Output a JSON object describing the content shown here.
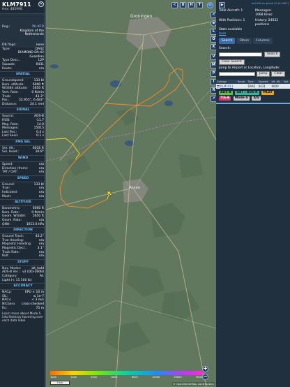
{
  "aircraft": {
    "callsign": "KLM7911",
    "hex_line": "Hex: 485998",
    "reg_label": "Reg.:",
    "reg_value": "PH-KFD",
    "country": "Kingdom of the Netherlands",
    "db_flags_label": "DB flags:",
    "db_flags_value": "none",
    "type_label": "Type:",
    "type_value": "DA42",
    "type_desc": "DIAMOND DA-42 Guardian",
    "type_desc_label": "Type Desc.:",
    "type_desc_value": "L2P",
    "squawk_label": "Squawk:",
    "squawk_value": "0431",
    "route_label": "Route:",
    "route_value": "n/a"
  },
  "sections": {
    "spatial": "SPATIAL",
    "signal": "SIGNAL",
    "fms_sel": "FMS SEL",
    "wind": "WIND",
    "speed": "SPEED",
    "altitude": "ALTITUDE",
    "direction": "DIRECTION",
    "stuff": "STUFF",
    "accuracy": "ACCURACY"
  },
  "spatial": [
    {
      "k": "Groundspeed:",
      "v": "133 kt"
    },
    {
      "k": "Baro. altitude:",
      "v": "6000 ft"
    },
    {
      "k": "WGS84 altitude:",
      "v": "5650 ft"
    },
    {
      "k": "Vert. Rate:",
      "v": "0 ft/min"
    },
    {
      "k": "Track:",
      "v": "43.3°"
    },
    {
      "k": "Pos.:",
      "v": "52.955°, 6.483°"
    },
    {
      "k": "Distance:",
      "v": "24.1 nmi"
    }
  ],
  "signal": [
    {
      "k": "Source:",
      "v": "ADS-B"
    },
    {
      "k": "RSSI:",
      "v": "-11.7"
    },
    {
      "k": "Msg. Rate:",
      "v": "14.0"
    },
    {
      "k": "Messages:",
      "v": "15015"
    },
    {
      "k": "Last Pos.:",
      "v": "0.4 s"
    },
    {
      "k": "Last Seen:",
      "v": "0.1 s"
    }
  ],
  "fms": [
    {
      "k": "Sel. Alt.:",
      "v": "6016 ft"
    },
    {
      "k": "Sel. Head.:",
      "v": "30.9°"
    }
  ],
  "wind": [
    {
      "k": "Speed:",
      "v": "n/a"
    },
    {
      "k": "Direction (from):",
      "v": "n/a"
    },
    {
      "k": "TAT / OAT:",
      "v": "n/a"
    }
  ],
  "speed": [
    {
      "k": "Ground:",
      "v": "133 kt"
    },
    {
      "k": "True:",
      "v": "n/a"
    },
    {
      "k": "Indicated:",
      "v": "n/a"
    },
    {
      "k": "Mach:",
      "v": "n/a"
    }
  ],
  "altitude": [
    {
      "k": "Barometric:",
      "v": "6000 ft"
    },
    {
      "k": "Baro. Rate:",
      "v": "0 ft/min"
    },
    {
      "k": "Geom. WGS84:",
      "v": "5650 ft"
    },
    {
      "k": "Geom. Rate:",
      "v": "n/a"
    },
    {
      "k": "QNH:",
      "v": "1013.6 hPa"
    }
  ],
  "direction": [
    {
      "k": "Ground Track:",
      "v": "43.2°"
    },
    {
      "k": "True Heading:",
      "v": "n/a"
    },
    {
      "k": "Magnetic Heading:",
      "v": "n/a"
    },
    {
      "k": "Magnetic Decl.:",
      "v": "3.1°"
    },
    {
      "k": "Track Rate:",
      "v": "n/a"
    },
    {
      "k": "Roll:",
      "v": "n/a"
    }
  ],
  "stuff": [
    {
      "k": "Nav. Modes:",
      "v": "alt_hold"
    },
    {
      "k": "ADS-B Ver.:",
      "v": "v2 (DO-260B)"
    },
    {
      "k": "Category:",
      "v": "A1"
    },
    {
      "k": "Light (< 15 500 lb)",
      "v": ""
    }
  ],
  "accuracy": [
    {
      "k": "NACp:",
      "v": "EPU < 10 m"
    },
    {
      "k": "SIL:",
      "v": "≤ 1e-7"
    },
    {
      "k": "NACv:",
      "v": "< 3 m/s"
    },
    {
      "k": "NICbaro:",
      "v": "cross-checked"
    },
    {
      "k": "Rc:",
      "v": "75 m"
    }
  ],
  "footer_text": "Learn more about Mode S info fields by hovering over each data label",
  "map": {
    "city_north": "Groningen",
    "city_south": "Assen",
    "attribution": "© OpenStreetMap contributors",
    "scale": "5 km",
    "legend_ticks": [
      "1000",
      "2000",
      "4000",
      "6000",
      "8000",
      "10000",
      "20000",
      "30000"
    ]
  },
  "map_buttons": [
    "<",
    "U",
    "H",
    "T",
    "L",
    "O",
    "K",
    "V",
    "M",
    "P",
    "I",
    "R"
  ],
  "right": {
    "top_link": "tar1090 on github (3.14.1607)",
    "total_aircraft": "Total Aircraft: 1",
    "messages": "Messages: 1068.6/sec",
    "with_positions": "With Positions: 1",
    "history": "History: 24032 positions",
    "stats_available": "Stats available",
    "stats_link": "here",
    "tabs": [
      "Search",
      "Filters",
      "Columns"
    ],
    "search_label": "Search:",
    "search_button": "Search",
    "clear_search": "Clear Search",
    "jump_label": "Jump to Airport or Location, Longitude:",
    "jump_button": "Jump",
    "clear_button": "Clear",
    "columns": [
      "Callsign",
      "Route",
      "Type",
      "Squawk",
      "Alt. (ft)",
      "Spd"
    ],
    "row": {
      "callsign": "KLM7911",
      "type": "DA42",
      "squawk": "0431",
      "alt": "6000"
    },
    "legend": [
      "ADS-B",
      "UAT / ADS-R",
      "MLAT",
      "TIS-B",
      "Mode-S",
      "AIS"
    ]
  }
}
